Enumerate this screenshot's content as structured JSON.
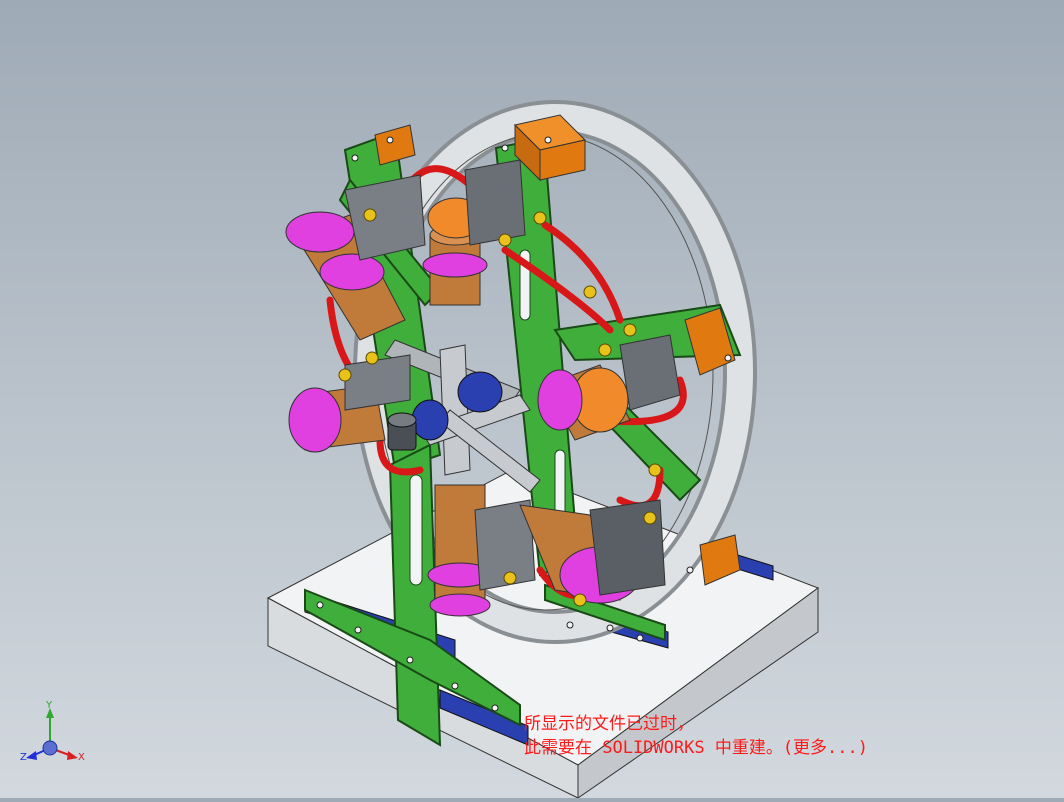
{
  "viewport": {
    "background_top": "#9eaab6",
    "background_bottom": "#d2d8de"
  },
  "notice": {
    "line1": "所显示的文件已过时，",
    "line2": "此需要在 SOLIDWORKS 中重建。(更多...)",
    "color": "#ff1a1a"
  },
  "triad": {
    "x_label": "X",
    "y_label": "Y",
    "z_label": "Z"
  },
  "model": {
    "colors": {
      "frame": "#3fae3a",
      "base": "#e9ecee",
      "rail": "#2a3fb0",
      "flywheel": "#cfd3d6",
      "cylinder": "#c07a3a",
      "flange": "#e040e0",
      "pipe": "#e02020",
      "block": "#e07a10",
      "head": "#5a5f66"
    }
  }
}
